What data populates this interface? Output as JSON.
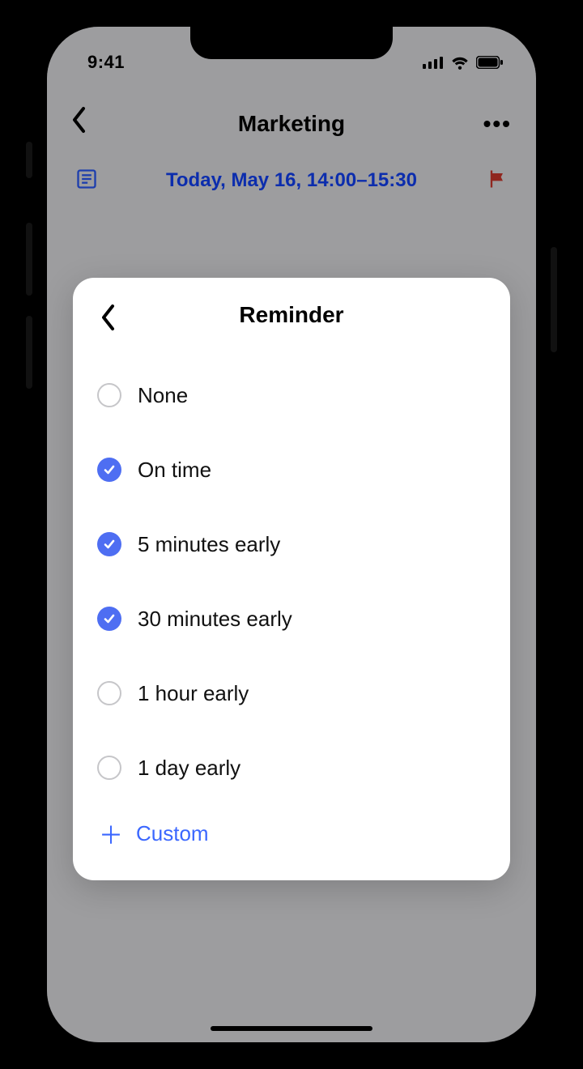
{
  "status": {
    "time": "9:41"
  },
  "header": {
    "title": "Marketing"
  },
  "event": {
    "datetime": "Today, May 16, 14:00–15:30"
  },
  "modal": {
    "title": "Reminder",
    "options": [
      {
        "label": "None",
        "checked": false
      },
      {
        "label": "On time",
        "checked": true
      },
      {
        "label": "5 minutes early",
        "checked": true
      },
      {
        "label": "30 minutes early",
        "checked": true
      },
      {
        "label": "1 hour early",
        "checked": false
      },
      {
        "label": "1 day early",
        "checked": false
      }
    ],
    "custom_label": "Custom"
  }
}
